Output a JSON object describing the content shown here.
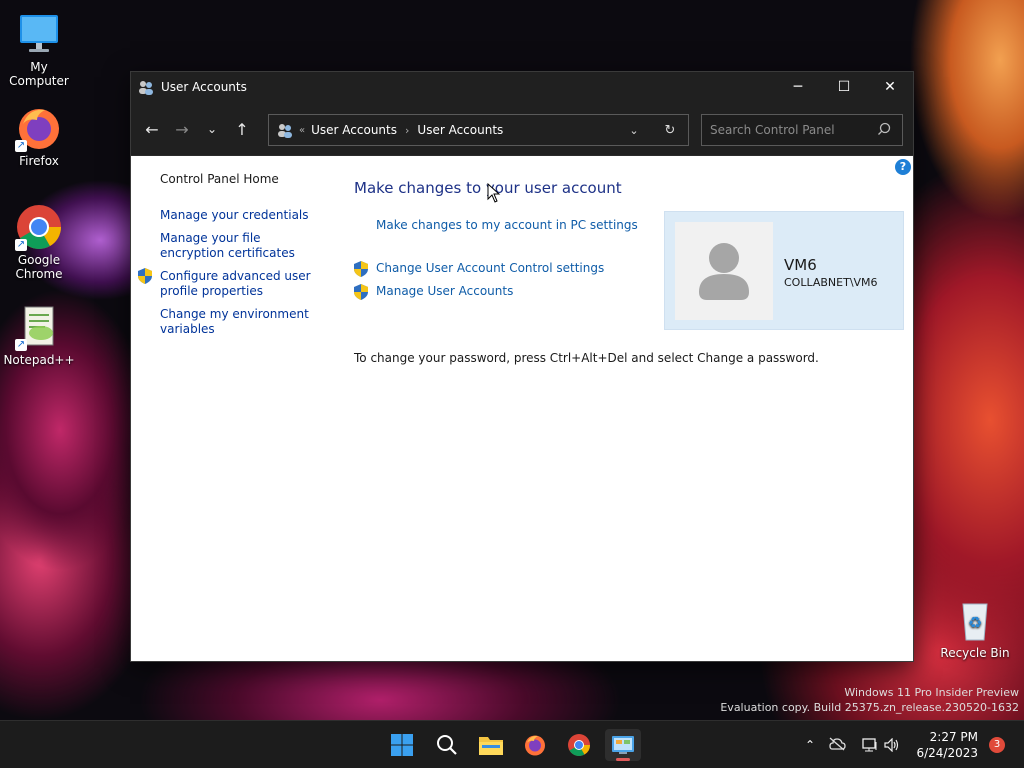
{
  "desktop": {
    "icons": [
      {
        "label": "My Computer",
        "icon": "monitor-icon"
      },
      {
        "label": "Firefox",
        "icon": "firefox-icon"
      },
      {
        "label": "Google Chrome",
        "icon": "chrome-icon"
      },
      {
        "label": "Notepad++",
        "icon": "notepadpp-icon"
      },
      {
        "label": "Recycle Bin",
        "icon": "recycle-bin-icon"
      }
    ],
    "watermark_line1": "Windows 11 Pro Insider Preview",
    "watermark_line2": "Evaluation copy. Build 25375.zn_release.230520-1632"
  },
  "window": {
    "title": "User Accounts",
    "controls": {
      "minimize": "─",
      "maximize": "☐",
      "close": "✕"
    },
    "address": {
      "overflow": "«",
      "crumbs": [
        "User Accounts",
        "User Accounts"
      ]
    },
    "search": {
      "placeholder": "Search Control Panel"
    },
    "help": "?",
    "leftnav": {
      "home": "Control Panel Home",
      "items": [
        "Manage your credentials",
        "Manage your file encryption certificates",
        "Configure advanced user profile properties",
        "Change my environment variables"
      ]
    },
    "main": {
      "heading": "Make changes to your user account",
      "pc_settings_link": "Make changes to my account in PC settings",
      "uac_link": "Change User Account Control settings",
      "manage_link": "Manage User Accounts",
      "password_note": "To change your password, press Ctrl+Alt+Del and select Change a password."
    },
    "account": {
      "name": "VM6",
      "domain_user": "COLLABNET\\VM6"
    }
  },
  "taskbar": {
    "time": "2:27 PM",
    "date": "6/24/2023",
    "notification_count": "3"
  },
  "colors": {
    "link": "#0f5ca8",
    "heading": "#1e3287",
    "card": "#dcebf7",
    "titlebar": "#202020"
  }
}
